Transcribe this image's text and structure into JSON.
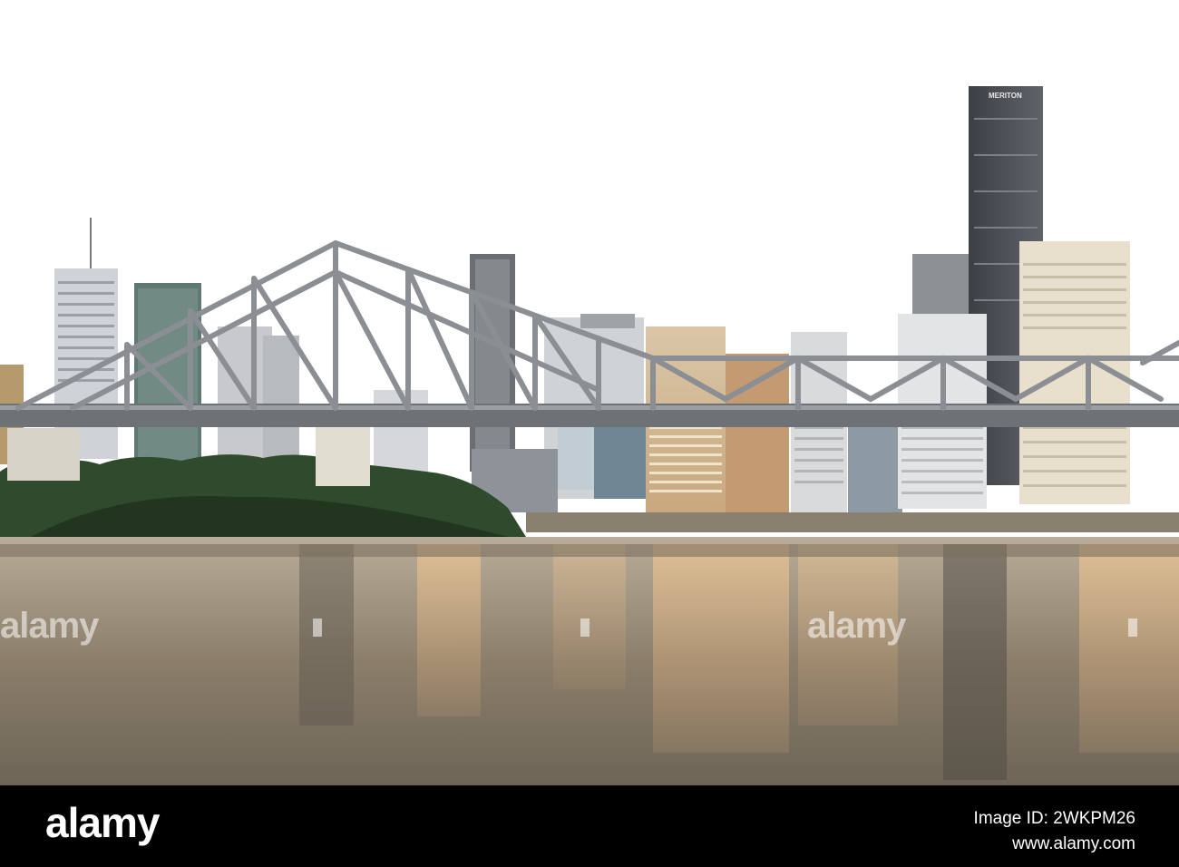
{
  "photo": {
    "scene": "Story Bridge and Brisbane city skyline at dusk over the river",
    "tower_sign": "MERITON"
  },
  "watermark": {
    "text": "alamy"
  },
  "footer": {
    "logo": "alamy",
    "image_id": "Image ID: 2WKPM26",
    "url": "www.alamy.com"
  },
  "colors": {
    "sky": "#ffffff",
    "bridge": "#8b8f94",
    "water_dark": "#5d5a52",
    "water_glow": "#d8b98f",
    "trees": "#2f4a2c",
    "footer_bg": "#000000"
  }
}
